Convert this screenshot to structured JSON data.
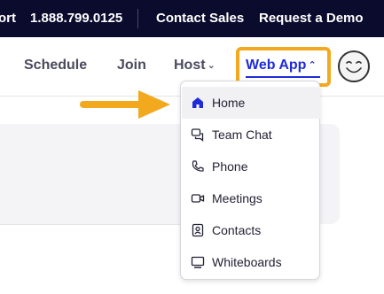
{
  "topbar": {
    "support_fragment": "ort",
    "phone": "1.888.799.0125",
    "contact_sales": "Contact Sales",
    "request_demo": "Request a Demo"
  },
  "nav": {
    "schedule": "Schedule",
    "join": "Join",
    "host": "Host",
    "web_app": "Web App"
  },
  "colors": {
    "topbar_bg": "#0b0b2e",
    "accent_blue": "#1f2bd8",
    "highlight_orange": "#f2a91e"
  },
  "menu": {
    "items": [
      {
        "label": "Home",
        "icon": "home-icon",
        "active": true
      },
      {
        "label": "Team Chat",
        "icon": "chat-icon",
        "active": false
      },
      {
        "label": "Phone",
        "icon": "phone-icon",
        "active": false
      },
      {
        "label": "Meetings",
        "icon": "video-camera-icon",
        "active": false
      },
      {
        "label": "Contacts",
        "icon": "contacts-icon",
        "active": false
      },
      {
        "label": "Whiteboards",
        "icon": "whiteboard-icon",
        "active": false
      }
    ]
  }
}
